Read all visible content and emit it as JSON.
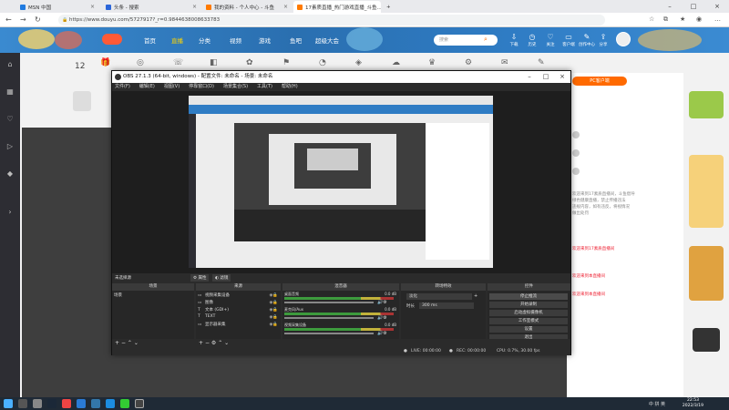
{
  "browser": {
    "tabs": [
      {
        "label": "MSN 中国",
        "color": "#1f7ae0"
      },
      {
        "label": "头条 - 搜索",
        "color": "#2b66d9"
      },
      {
        "label": "我的资料 - 个人中心 - 斗鱼",
        "color": "#ff7a00"
      },
      {
        "label": "17素质直播_热门游戏直播_斗鱼...",
        "color": "#ff7a00"
      }
    ],
    "new_tab": "+",
    "url": "https://www.douyu.com/5727917?_r=0.9844638008633783"
  },
  "site": {
    "nav": [
      "首页",
      "直播",
      "分类",
      "视频",
      "游戏",
      "鱼吧",
      "超级大会"
    ],
    "active_nav": "直播",
    "search_placeholder": "搜索",
    "header_icons": [
      "下载",
      "历史",
      "关注",
      "客户端",
      "创作中心",
      "分享"
    ],
    "follower_count": "12",
    "right_red_lines": [
      "欢迎来到17素质直播间",
      "欢迎来到本直播间",
      "欢迎来到本直播间"
    ],
    "right_gray_lines": [
      "欢迎来到17素质直播间，斗鱼倡导",
      "绿色健康直播，禁止传播违法",
      "违规内容，如有违反，将视情况",
      "做出处罚"
    ],
    "promo_label": "PC客户端"
  },
  "obs": {
    "title": "OBS 27.1.3 (64-bit, windows) - 配置文件: 未命名 - 场景: 未命名",
    "menu": [
      "文件(F)",
      "编辑(E)",
      "视图(V)",
      "停靠窗口(D)",
      "场景集合(S)",
      "工具(T)",
      "帮助(H)"
    ],
    "source_bar_label": "未选择源",
    "properties": "属性",
    "filters": "滤镜",
    "panels": {
      "scenes": "场景",
      "sources": "来源",
      "mixer": "混音器",
      "transitions": "转场特效",
      "controls": "控件"
    },
    "scene_items": [
      "场景"
    ],
    "source_items": [
      {
        "icon": "▭",
        "label": "视频采集设备"
      },
      {
        "icon": "▭",
        "label": "图像"
      },
      {
        "icon": "T",
        "label": "文本 (GDI+)"
      },
      {
        "icon": "T",
        "label": "TEXT"
      },
      {
        "icon": "▭",
        "label": "显示器采集"
      }
    ],
    "mixer": [
      {
        "name": "桌面音频",
        "db": "0.0 dB"
      },
      {
        "name": "麦克风/Aux",
        "db": "0.0 dB"
      },
      {
        "name": "视频采集设备",
        "db": "0.0 dB"
      }
    ],
    "transition": {
      "type": "淡化",
      "duration_label": "时长",
      "duration": "300 ms"
    },
    "controls": [
      "停止推流",
      "开始录制",
      "启动虚拟摄像机",
      "工作室模式",
      "设置",
      "退出"
    ],
    "status": {
      "live": "LIVE: 00:00:00",
      "rec": "REC: 00:00:00",
      "cpu": "CPU: 0.7%, 30.00 fps"
    }
  },
  "taskbar": {
    "time": "22:53",
    "date": "2022/3/19",
    "tray": "中 拼 英"
  }
}
